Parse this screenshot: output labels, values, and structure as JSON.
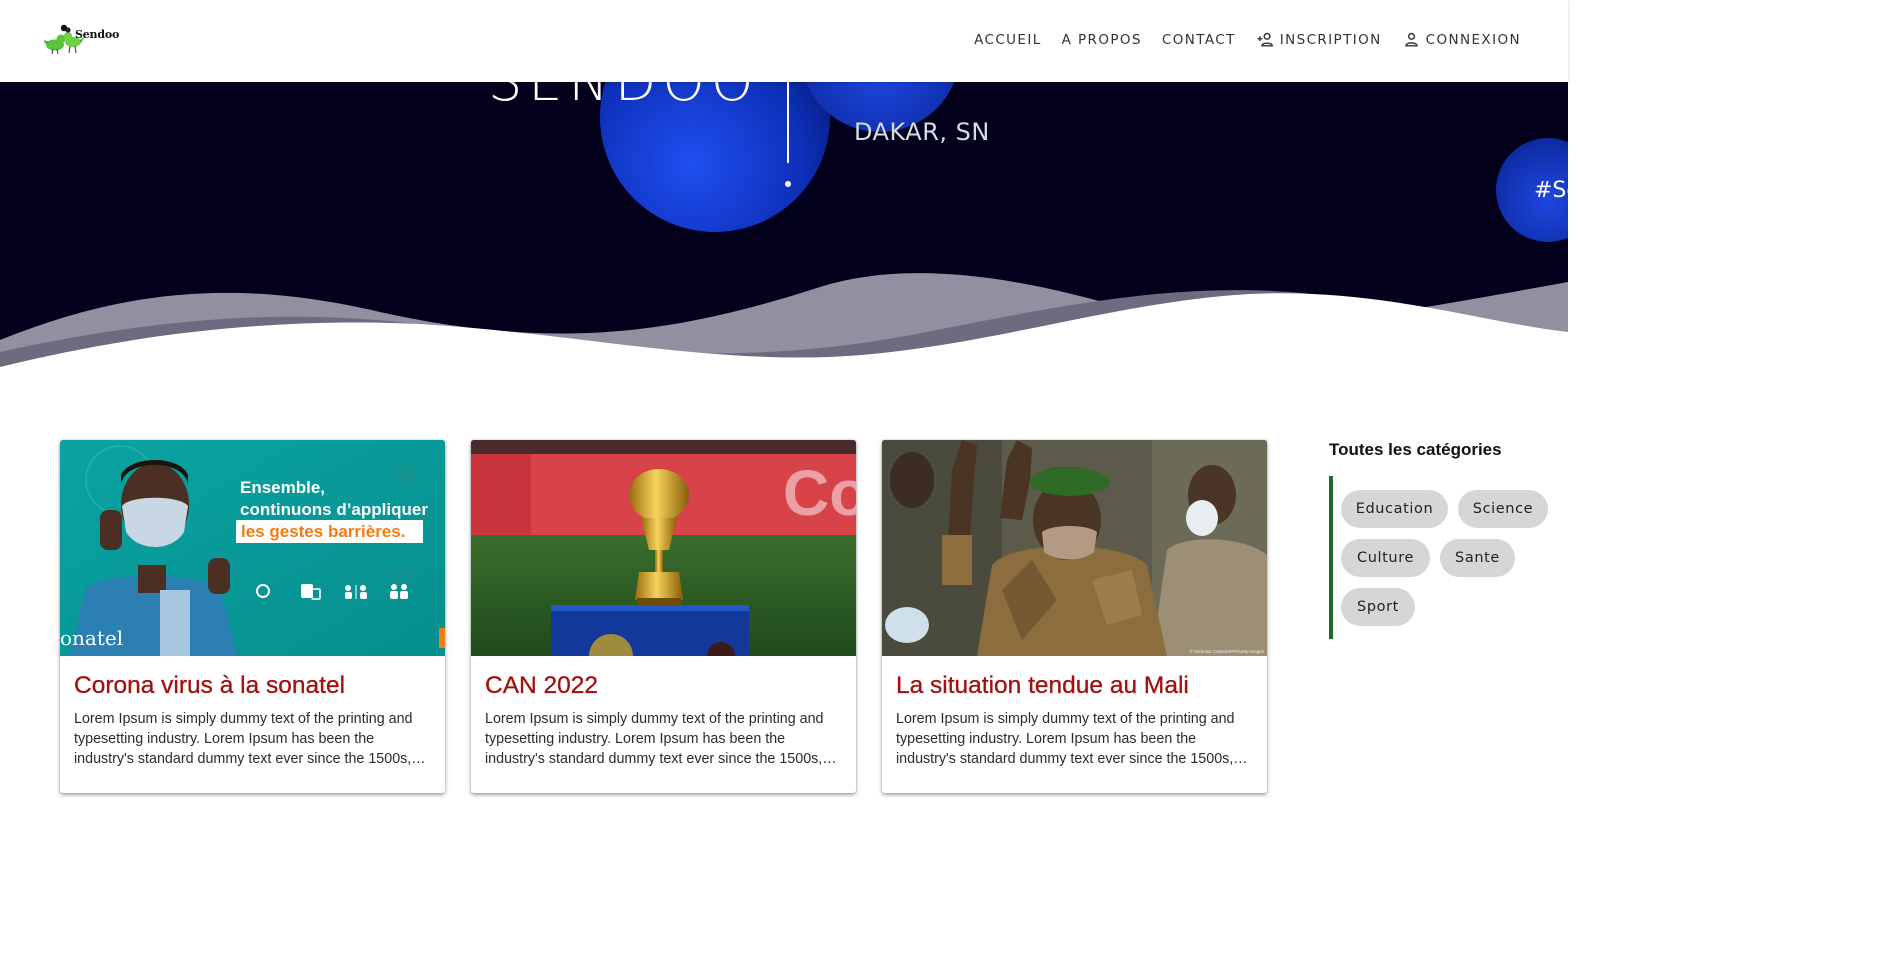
{
  "brand": {
    "logo_text": "Sendoo"
  },
  "nav": {
    "items": [
      {
        "label": "ACCUEIL",
        "icon": ""
      },
      {
        "label": "A PROPOS",
        "icon": ""
      },
      {
        "label": "CONTACT",
        "icon": ""
      },
      {
        "label": "INSCRIPTION",
        "icon": "person-add-icon"
      },
      {
        "label": "CONNEXION",
        "icon": "person-icon"
      }
    ]
  },
  "hero": {
    "brand_text": "SENDOO",
    "location": "DAKAR, SN",
    "hashtag": "#Se"
  },
  "articles": [
    {
      "title": "Corona virus à la sonatel",
      "excerpt": "Lorem Ipsum is simply dummy text of the printing and typesetting industry. Lorem Ipsum has been the industry's standard dummy text ever since the 1500s, when an unknown printer took a galley of type and scrambled it to make a type specimen book.",
      "image": {
        "headline_line1": "Ensemble,",
        "headline_line2": "continuons d’appliquer",
        "headline_highlight": "les gestes barrières.",
        "brand": "onatel"
      }
    },
    {
      "title": "CAN 2022",
      "excerpt": "Lorem Ipsum is simply dummy text of the printing and typesetting industry. Lorem Ipsum has been the industry's standard dummy text ever since the 1500s, when an unknown printer took a galley of type and scrambled it to make a type specimen book.",
      "image": {
        "board_text": "Co"
      }
    },
    {
      "title": "La situation tendue au Mali",
      "excerpt": "Lorem Ipsum is simply dummy text of the printing and typesetting industry. Lorem Ipsum has been the industry's standard dummy text ever since the 1500s, when an unknown printer took a galley of type and scrambled it to make a type specimen book.",
      "image": {
        "credit": "© Nicholas Cotton/AFP/Getty Images"
      }
    }
  ],
  "sidebar": {
    "title": "Toutes les catégories",
    "categories": [
      "Education",
      "Science",
      "Culture",
      "Sante",
      "Sport"
    ]
  },
  "colors": {
    "hero_bg": "#03001c",
    "accent_green": "#1d6b2e",
    "title_red": "#a31010",
    "chip_bg": "#d6d6d6"
  }
}
